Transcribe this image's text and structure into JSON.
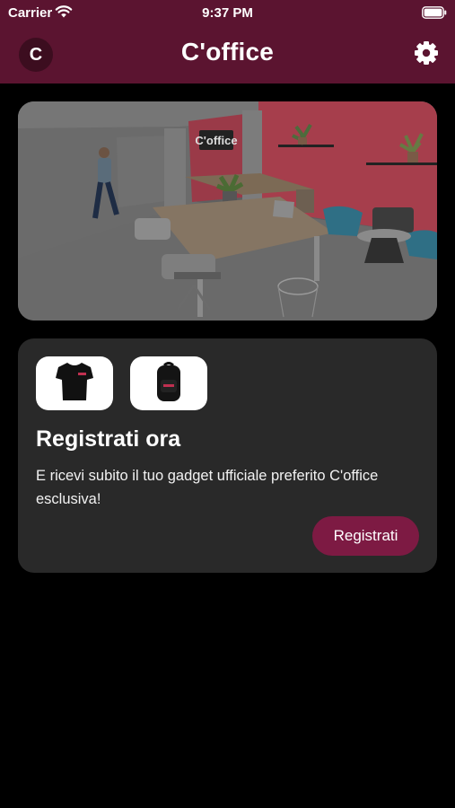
{
  "status_bar": {
    "carrier": "Carrier",
    "time": "9:37 PM"
  },
  "header": {
    "avatar_initial": "C",
    "title": "C'office",
    "settings_icon": "gear-icon"
  },
  "photo": {
    "sign_text": "C'office"
  },
  "promo": {
    "gadgets": [
      {
        "icon": "tshirt-icon"
      },
      {
        "icon": "backpack-icon"
      }
    ],
    "title": "Registrati ora",
    "text": "E ricevi subito il tuo gadget ufficiale preferito C'office esclusiva!",
    "button_label": "Registrati"
  },
  "colors": {
    "brand_maroon": "#5b1430",
    "button": "#7d1a43",
    "card": "#292929",
    "background": "#000000"
  }
}
